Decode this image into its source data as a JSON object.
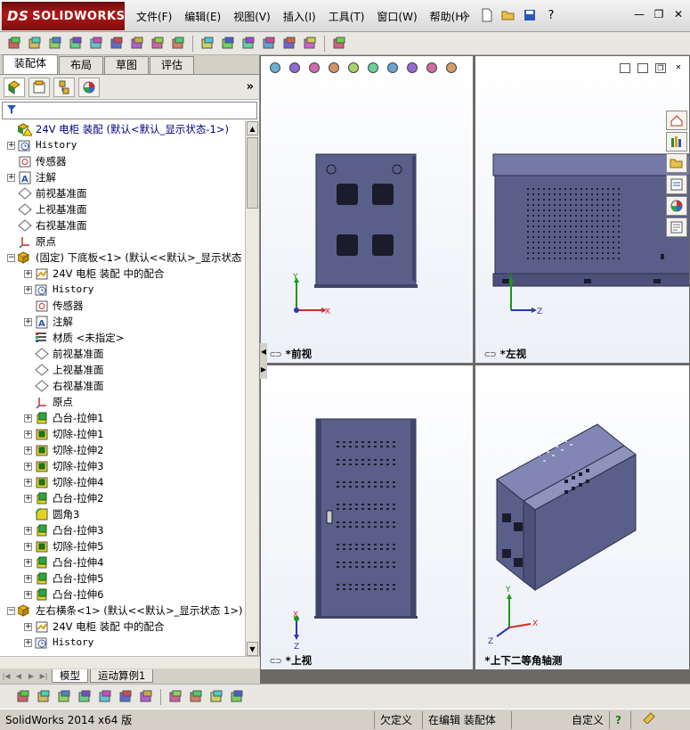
{
  "app": {
    "logo_ds": "DS",
    "logo_text": "SOLIDWORKS"
  },
  "menu": [
    "文件(F)",
    "编辑(E)",
    "视图(V)",
    "插入(I)",
    "工具(T)",
    "窗口(W)",
    "帮助(H)"
  ],
  "window_controls": [
    "?",
    "—",
    "❐",
    "✕"
  ],
  "left_tabs": [
    "装配体",
    "布局",
    "草图",
    "评估"
  ],
  "left_tabs_active": 0,
  "tree": [
    {
      "level": 0,
      "exp": "",
      "icon": "assembly-warning-icon",
      "text": "24V 电柜 装配  (默认<默认_显示状态-1>)",
      "color": "#000080"
    },
    {
      "level": 0,
      "exp": "+",
      "icon": "history-icon",
      "text": "History",
      "mono": true
    },
    {
      "level": 0,
      "exp": "",
      "icon": "sensor-icon",
      "text": "传感器"
    },
    {
      "level": 0,
      "exp": "+",
      "icon": "annotation-icon",
      "text": "注解"
    },
    {
      "level": 0,
      "exp": "",
      "icon": "plane-icon",
      "text": "前视基准面"
    },
    {
      "level": 0,
      "exp": "",
      "icon": "plane-icon",
      "text": "上视基准面"
    },
    {
      "level": 0,
      "exp": "",
      "icon": "plane-icon",
      "text": "右视基准面"
    },
    {
      "level": 0,
      "exp": "",
      "icon": "origin-icon",
      "text": "原点"
    },
    {
      "level": 0,
      "exp": "−",
      "icon": "part-icon",
      "text": "(固定) 下底板<1> (默认<<默认>_显示状态"
    },
    {
      "level": 1,
      "exp": "+",
      "icon": "mates-icon",
      "text": "24V 电柜 装配 中的配合"
    },
    {
      "level": 1,
      "exp": "+",
      "icon": "history-icon",
      "text": "History",
      "mono": true
    },
    {
      "level": 1,
      "exp": "",
      "icon": "sensor-icon",
      "text": "传感器"
    },
    {
      "level": 1,
      "exp": "+",
      "icon": "annotation-icon",
      "text": "注解"
    },
    {
      "level": 1,
      "exp": "",
      "icon": "material-icon",
      "text": "材质 <未指定>"
    },
    {
      "level": 1,
      "exp": "",
      "icon": "plane-icon",
      "text": "前视基准面"
    },
    {
      "level": 1,
      "exp": "",
      "icon": "plane-icon",
      "text": "上视基准面"
    },
    {
      "level": 1,
      "exp": "",
      "icon": "plane-icon",
      "text": "右视基准面"
    },
    {
      "level": 1,
      "exp": "",
      "icon": "origin-icon",
      "text": "原点"
    },
    {
      "level": 1,
      "exp": "+",
      "icon": "boss-extrude-icon",
      "text": "凸台-拉伸1"
    },
    {
      "level": 1,
      "exp": "+",
      "icon": "cut-extrude-icon",
      "text": "切除-拉伸1"
    },
    {
      "level": 1,
      "exp": "+",
      "icon": "cut-extrude-icon",
      "text": "切除-拉伸2"
    },
    {
      "level": 1,
      "exp": "+",
      "icon": "cut-extrude-icon",
      "text": "切除-拉伸3"
    },
    {
      "level": 1,
      "exp": "+",
      "icon": "cut-extrude-icon",
      "text": "切除-拉伸4"
    },
    {
      "level": 1,
      "exp": "+",
      "icon": "boss-extrude-icon",
      "text": "凸台-拉伸2"
    },
    {
      "level": 1,
      "exp": "",
      "icon": "fillet-icon",
      "text": "圆角3"
    },
    {
      "level": 1,
      "exp": "+",
      "icon": "boss-extrude-icon",
      "text": "凸台-拉伸3"
    },
    {
      "level": 1,
      "exp": "+",
      "icon": "cut-extrude-icon",
      "text": "切除-拉伸5"
    },
    {
      "level": 1,
      "exp": "+",
      "icon": "boss-extrude-icon",
      "text": "凸台-拉伸4"
    },
    {
      "level": 1,
      "exp": "+",
      "icon": "boss-extrude-icon",
      "text": "凸台-拉伸5"
    },
    {
      "level": 1,
      "exp": "+",
      "icon": "boss-extrude-icon",
      "text": "凸台-拉伸6"
    },
    {
      "level": 0,
      "exp": "−",
      "icon": "part-icon",
      "text": "左右横条<1> (默认<<默认>_显示状态 1>)"
    },
    {
      "level": 1,
      "exp": "+",
      "icon": "mates-icon",
      "text": "24V 电柜 装配 中的配合"
    },
    {
      "level": 1,
      "exp": "+",
      "icon": "history-icon",
      "text": "History",
      "mono": true
    }
  ],
  "bottom_tabs": [
    "模型",
    "运动算例1"
  ],
  "viewports": [
    {
      "label": "*前视",
      "axes": [
        "Y",
        "X"
      ]
    },
    {
      "label": "*左视",
      "axes": [
        "Y",
        "Z"
      ]
    },
    {
      "label": "*上视",
      "axes": [
        "X",
        "Z"
      ]
    },
    {
      "label": "*上下二等角轴测",
      "axes": [
        "Y",
        "X",
        "Z"
      ]
    }
  ],
  "status": {
    "product": "SolidWorks 2014 x64 版",
    "underdefined": "欠定义",
    "editing": "在编辑 装配体",
    "custom": "自定义",
    "help": "?"
  },
  "colors": {
    "cabinet": "#5a5f8a",
    "cabinet_dark": "#40446a",
    "cabinet_light": "#7479a6"
  }
}
